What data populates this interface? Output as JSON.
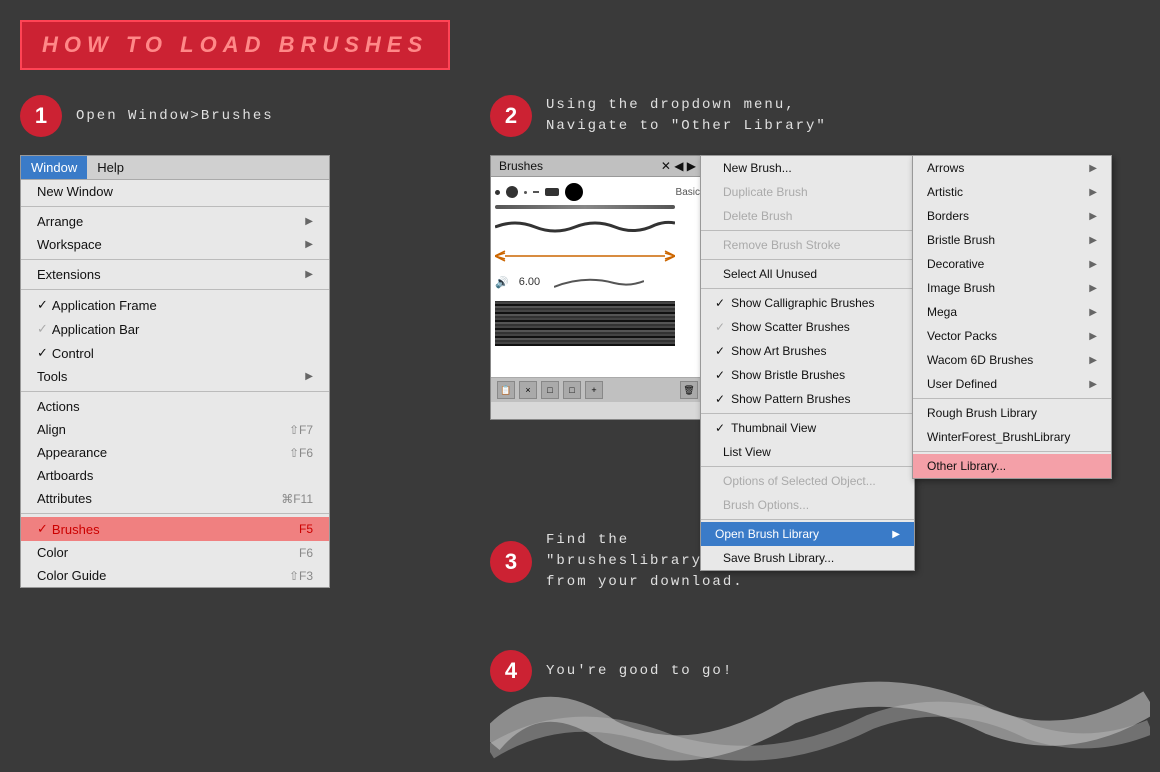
{
  "header": {
    "title": "HOW TO LOAD BRUSHES"
  },
  "steps": [
    {
      "number": "1",
      "text": "Open Window>Brushes"
    },
    {
      "number": "2",
      "text": "Using the dropdown menu,\nNavigate to \"Other Library\""
    },
    {
      "number": "3",
      "text": "Find the\n\"brusheslibrary.ai\"\nfrom your download."
    },
    {
      "number": "4",
      "text": "You're good to go!"
    }
  ],
  "window_menu": {
    "bar": [
      "Window",
      "Help"
    ],
    "items": [
      {
        "label": "New Window",
        "type": "item"
      },
      {
        "label": "separator"
      },
      {
        "label": "Arrange",
        "type": "submenu"
      },
      {
        "label": "Workspace",
        "type": "submenu"
      },
      {
        "label": "separator"
      },
      {
        "label": "Extensions",
        "type": "submenu"
      },
      {
        "label": "separator"
      },
      {
        "label": "Application Frame",
        "type": "checked"
      },
      {
        "label": "Application Bar",
        "type": "checked-light"
      },
      {
        "label": "✓ Control",
        "type": "item"
      },
      {
        "label": "Tools",
        "type": "submenu"
      },
      {
        "label": "separator"
      },
      {
        "label": "Actions",
        "type": "item"
      },
      {
        "label": "Align",
        "type": "shortcut",
        "shortcut": "⇧F7"
      },
      {
        "label": "Appearance",
        "type": "shortcut",
        "shortcut": "⇧F6"
      },
      {
        "label": "Artboards",
        "type": "item"
      },
      {
        "label": "Attributes",
        "type": "shortcut",
        "shortcut": "⌘F11"
      },
      {
        "label": "separator"
      },
      {
        "label": "Brushes",
        "type": "active",
        "shortcut": "F5"
      },
      {
        "label": "Color",
        "type": "item",
        "shortcut": "F6"
      },
      {
        "label": "Color Guide",
        "type": "shortcut",
        "shortcut": "⇧F3"
      }
    ]
  },
  "dropdown_menu": {
    "items": [
      {
        "label": "New Brush...",
        "type": "item"
      },
      {
        "label": "Duplicate Brush",
        "type": "disabled"
      },
      {
        "label": "Delete Brush",
        "type": "disabled"
      },
      {
        "label": "separator"
      },
      {
        "label": "Remove Brush Stroke",
        "type": "disabled"
      },
      {
        "label": "separator"
      },
      {
        "label": "Select All Unused",
        "type": "item"
      },
      {
        "label": "separator"
      },
      {
        "label": "Show Calligraphic Brushes",
        "type": "checked"
      },
      {
        "label": "Show Scatter Brushes",
        "type": "checked-gray"
      },
      {
        "label": "Show Art Brushes",
        "type": "checked"
      },
      {
        "label": "Show Bristle Brushes",
        "type": "checked"
      },
      {
        "label": "Show Pattern Brushes",
        "type": "checked"
      },
      {
        "label": "separator"
      },
      {
        "label": "Thumbnail View",
        "type": "checked"
      },
      {
        "label": "List View",
        "type": "item"
      },
      {
        "label": "separator"
      },
      {
        "label": "Options of Selected Object...",
        "type": "disabled"
      },
      {
        "label": "Brush Options...",
        "type": "disabled"
      },
      {
        "label": "separator"
      },
      {
        "label": "Open Brush Library",
        "type": "highlighted",
        "has_arrow": true
      },
      {
        "label": "Save Brush Library...",
        "type": "item"
      }
    ]
  },
  "submenu": {
    "items": [
      {
        "label": "Arrows",
        "has_arrow": true
      },
      {
        "label": "Artistic",
        "has_arrow": true
      },
      {
        "label": "Borders",
        "has_arrow": true
      },
      {
        "label": "Bristle Brush",
        "has_arrow": true
      },
      {
        "label": "Decorative",
        "has_arrow": true
      },
      {
        "label": "Image Brush",
        "has_arrow": true
      },
      {
        "label": "Mega",
        "has_arrow": true
      },
      {
        "label": "Vector Packs",
        "has_arrow": true
      },
      {
        "label": "Wacom 6D Brushes",
        "has_arrow": true
      },
      {
        "label": "User Defined",
        "has_arrow": true
      },
      {
        "label": "separator"
      },
      {
        "label": "Rough Brush Library",
        "has_arrow": false
      },
      {
        "label": "WinterForest_BrushLibrary",
        "has_arrow": false
      },
      {
        "label": "separator"
      },
      {
        "label": "Other Library...",
        "type": "highlighted-pink"
      }
    ]
  }
}
